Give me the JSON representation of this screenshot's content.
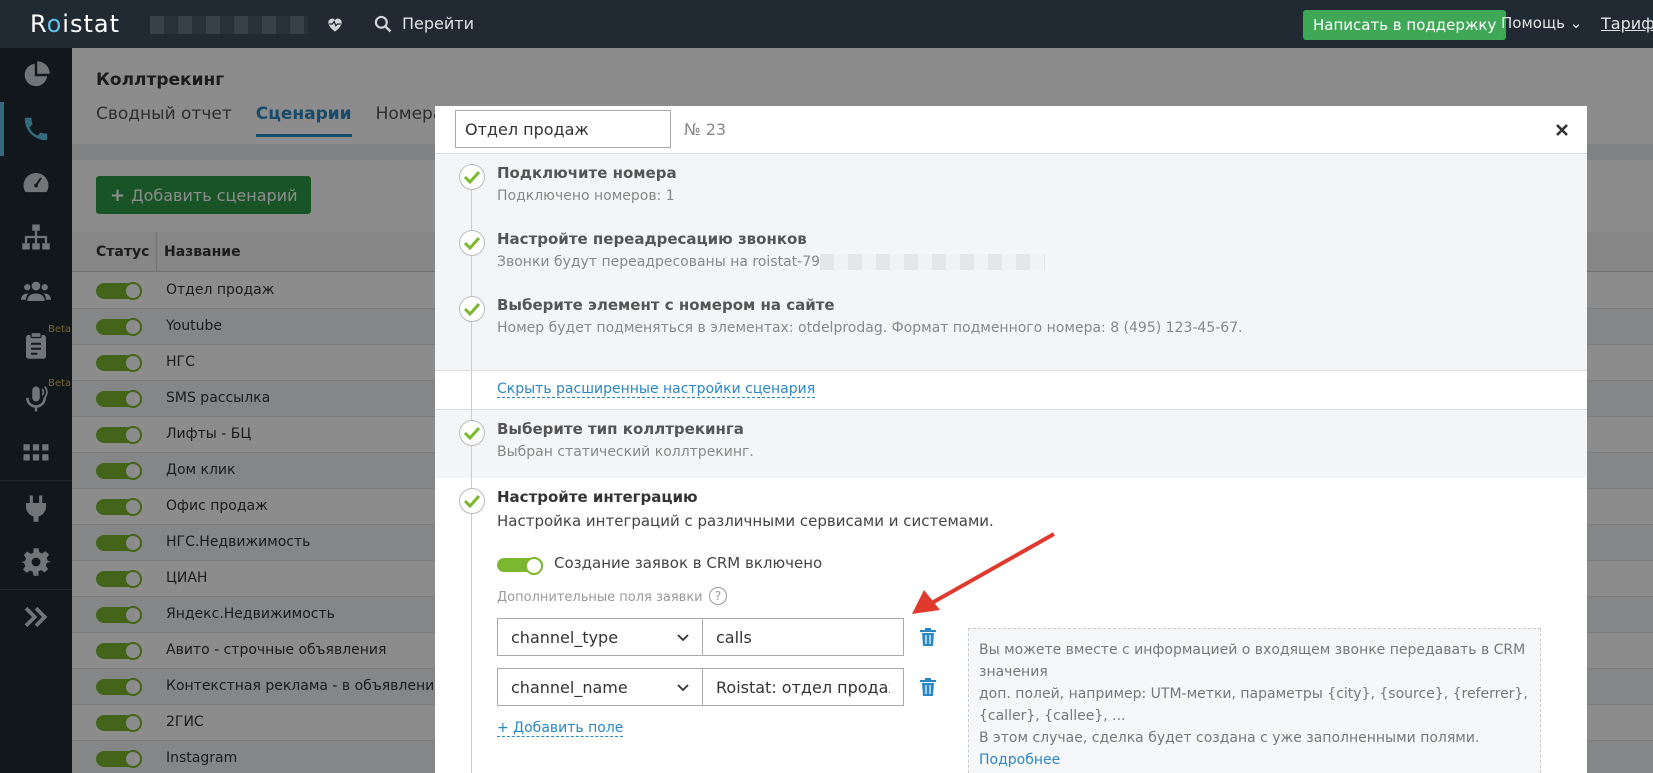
{
  "topbar": {
    "logo_pre": "R",
    "logo_o": "o",
    "logo_post": "istat",
    "goto_label": "Перейти",
    "support_label": "Написать в поддержку",
    "help_label": "Помощь",
    "tariff_label": "Тариф:"
  },
  "sidebar": {
    "items": [
      {
        "icon": "pie-chart-icon"
      },
      {
        "icon": "phone-icon",
        "active": true
      },
      {
        "icon": "dashboard-icon"
      },
      {
        "icon": "sitemap-icon"
      },
      {
        "icon": "users-icon"
      },
      {
        "icon": "clipboard-icon",
        "beta": "Beta"
      },
      {
        "icon": "microphone-icon",
        "beta": "Beta"
      },
      {
        "icon": "apps-grid-icon"
      },
      {
        "icon": "plug-icon"
      },
      {
        "icon": "gear-icon"
      },
      {
        "icon": "expand-icon"
      }
    ]
  },
  "page": {
    "title": "Коллтрекинг",
    "tabs": [
      "Сводный отчет",
      "Сценарии",
      "Номера"
    ],
    "active_tab": 1,
    "add_button": "Добавить сценарий",
    "columns": {
      "status": "Статус",
      "name": "Название"
    },
    "rows": [
      "Отдел продаж",
      "Youtube",
      "НГС",
      "SMS рассылка",
      "Лифты - БЦ",
      "Дом клик",
      "Офис продаж",
      "НГС.Недвижимость",
      "ЦИАН",
      "Яндекс.Недвижимость",
      "Авито - строчные объявления",
      "Контекстная реклама - в объявлениях",
      "2ГИС",
      "Instagram"
    ]
  },
  "modal": {
    "name_value": "Отдел продаж",
    "number": "№ 23",
    "steps": [
      {
        "title": "Подключите номера",
        "sub": "Подключено номеров: 1"
      },
      {
        "title": "Настройте переадресацию звонков",
        "sub": "Звонки будут переадресованы на roistat-79"
      },
      {
        "title": "Выберите элемент с номером на сайте",
        "sub": "Номер будет подменяться в элементах: otdelprodag. Формат подменного номера: 8 (495) 123-45-67."
      }
    ],
    "advanced_link": "Скрыть расширенные настройки сценария",
    "type_step": {
      "title": "Выберите тип коллтрекинга",
      "sub": "Выбран статический коллтрекинг."
    },
    "integration_step": {
      "title": "Настройте интеграцию",
      "sub": "Настройка интеграций с различными сервисами и системами.",
      "crm_label": "Создание заявок в CRM включено",
      "extra_fields_label": "Дополнительные поля заявки",
      "help_mark": "?",
      "fields": [
        {
          "key": "channel_type",
          "value": "calls"
        },
        {
          "key": "channel_name",
          "value": "Roistat: отдел продаж"
        }
      ],
      "add_field": "+ Добавить поле",
      "hint": {
        "line1": "Вы можете вместе с информацией о входящем звонке передавать в CRM значения",
        "line2": "доп. полей, например: UTM-метки, параметры {city}, {source}, {referrer}, {caller}, {callee}, ...",
        "line3": "В этом случае, сделка будет создана с уже заполненными полями.",
        "more": "Подробнее"
      }
    },
    "close_mark": "×"
  },
  "colors": {
    "topbar": "#212a32",
    "accent_blue": "#2b87c3",
    "green": "#3fa857",
    "toggle_green": "#7cb82f",
    "arrow_red": "#e03a2f"
  }
}
